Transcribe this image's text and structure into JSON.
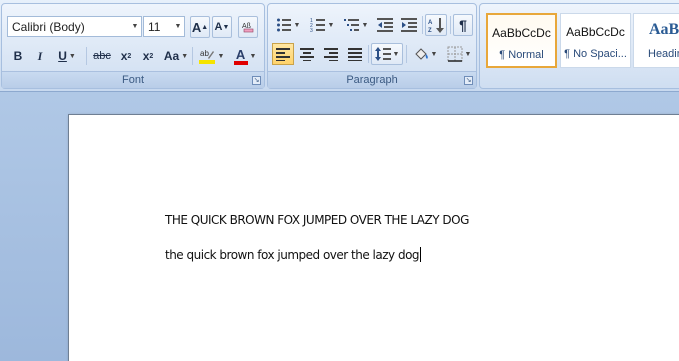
{
  "ribbon": {
    "font": {
      "label": "Font",
      "font_name": "Calibri (Body)",
      "font_size": "11",
      "grow_font": "A",
      "shrink_font": "A",
      "bold": "B",
      "italic": "I",
      "underline": "U",
      "strikethrough": "abc",
      "subscript": "x",
      "superscript": "x",
      "change_case": "Aa",
      "font_color": "A",
      "highlight_color": "#f5e400",
      "font_color_bar": "#e00000"
    },
    "paragraph": {
      "label": "Paragraph",
      "show_marks": "¶"
    },
    "styles": {
      "tiles": [
        {
          "sample": "AaBbCcDc",
          "name": "¶ Normal"
        },
        {
          "sample": "AaBbCcDc",
          "name": "¶ No Spaci..."
        },
        {
          "sample": "AaBb",
          "name": "Heading"
        }
      ]
    }
  },
  "document": {
    "line1": "THE QUICK BROWN FOX JUMPED OVER THE LAZY DOG",
    "line2": "the quick brown fox jumped over the lazy dog"
  }
}
